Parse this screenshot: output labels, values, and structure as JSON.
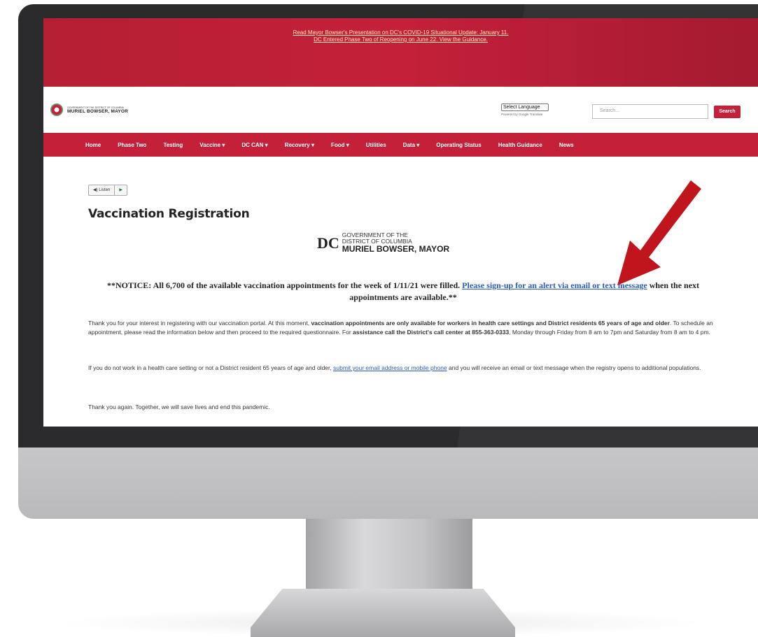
{
  "banner": {
    "line1": "Read Mayor Bowser's Presentation on DC's COVID-19 Situational Update: January 11.",
    "line2": "DC Entered Phase Two of Reopening on June 22. View the Guidance."
  },
  "header": {
    "brand_small": "GOVERNMENT OF THE DISTRICT OF COLUMBIA",
    "brand_main": "MURIEL BOWSER, MAYOR",
    "language_select": "Select Language",
    "powered_by": "Powered by Google Translate",
    "search_placeholder": "Search...",
    "search_button": "Search"
  },
  "nav": {
    "items": [
      {
        "label": "Home"
      },
      {
        "label": "Phase Two"
      },
      {
        "label": "Testing"
      },
      {
        "label": "Vaccine ▾"
      },
      {
        "label": "DC CAN ▾"
      },
      {
        "label": "Recovery ▾"
      },
      {
        "label": "Food ▾"
      },
      {
        "label": "Utilities"
      },
      {
        "label": "Data ▾"
      },
      {
        "label": "Operating Status"
      },
      {
        "label": "Health Guidance"
      },
      {
        "label": "News"
      }
    ]
  },
  "content": {
    "listen_label": "Listen",
    "title": "Vaccination Registration",
    "gov_logo": {
      "line1": "GOVERNMENT OF THE",
      "line2": "DISTRICT OF COLUMBIA",
      "mayor": "MURIEL BOWSER, MAYOR",
      "mark": "DC"
    },
    "notice": {
      "text1": "**NOTICE: All 6,700 of the available vaccination appointments for the week of 1/11/21 were filled. ",
      "link": "Please sign-up for an alert via email or text message",
      "text2": " when the next appointments are available.**"
    },
    "para1": {
      "a": "Thank you for your interest in registering with our vaccination portal. At this moment, ",
      "b": "vaccination appointments are only available for workers in health care settings and District residents 65 years of age and older",
      "c": ". To schedule an appointment, please read the information below and then proceed to the required questionnaire. For ",
      "d": "assistance call the District's call center at 855-363-0333",
      "e": ", Monday through Friday from 8 am to 7pm and Saturday from 8 am to 4 pm."
    },
    "para2": {
      "a": "If you do not work in a health care setting or not a District resident 65 years of age and older, ",
      "link": "submit your email address or mobile phone",
      "b": " and you will receive an email or text message when the registry opens to additional populations."
    },
    "para3": "Thank you again. Together, we will save lives and end this pandemic."
  },
  "colors": {
    "brand_red": "#c4203a",
    "link_blue": "#2a5db0",
    "arrow_red": "#c0151c"
  }
}
